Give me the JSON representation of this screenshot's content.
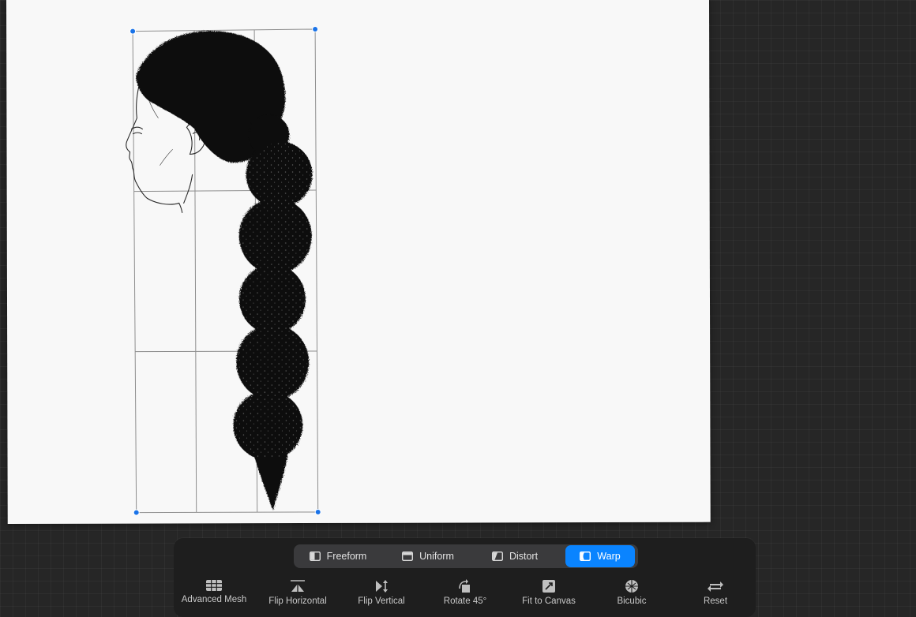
{
  "transform_modes": [
    {
      "label": "Freeform",
      "icon": "freeform-icon",
      "active": false
    },
    {
      "label": "Uniform",
      "icon": "uniform-icon",
      "active": false
    },
    {
      "label": "Distort",
      "icon": "distort-icon",
      "active": false
    },
    {
      "label": "Warp",
      "icon": "warp-icon",
      "active": true
    }
  ],
  "tools": [
    {
      "label": "Advanced Mesh",
      "icon": "mesh-icon"
    },
    {
      "label": "Flip Horizontal",
      "icon": "flip-horizontal-icon"
    },
    {
      "label": "Flip Vertical",
      "icon": "flip-vertical-icon"
    },
    {
      "label": "Rotate 45°",
      "icon": "rotate-icon"
    },
    {
      "label": "Fit to Canvas",
      "icon": "fit-to-canvas-icon"
    },
    {
      "label": "Bicubic",
      "icon": "bicubic-icon"
    },
    {
      "label": "Reset",
      "icon": "reset-icon"
    }
  ],
  "colors": {
    "accent": "#0a84ff",
    "handle": "#1a73e8",
    "canvas": "#f8f8f8",
    "toolbar": "#1e1e1e",
    "workspace": "#262626"
  }
}
